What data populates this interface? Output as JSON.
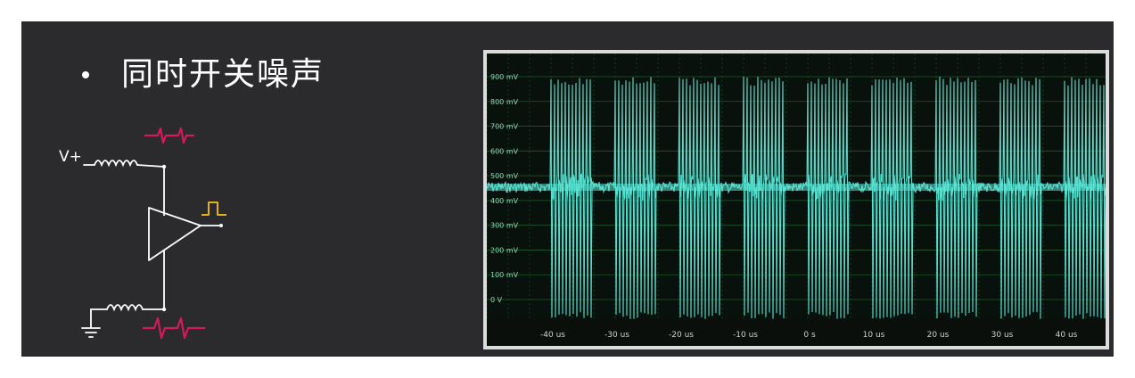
{
  "slide": {
    "bullet_text": "同时开关噪声"
  },
  "circuit": {
    "supply_label": "V+",
    "colors": {
      "wire": "#ffffff",
      "noise_glitch": "#d41a5a",
      "pulse": "#e2b020"
    },
    "icons": [
      "inductor-icon",
      "buffer-triangle-icon",
      "ground-icon",
      "pulse-icon",
      "glitch-icon"
    ]
  },
  "scope": {
    "colors": {
      "trace": "#5fe8d8",
      "grid": "#1f5a2a",
      "frame": "#dcdcdc"
    },
    "y_tick_labels": [
      "900 mV",
      "800 mV",
      "700 mV",
      "600 mV",
      "500 mV",
      "400 mV",
      "300 mV",
      "200 mV",
      "100 mV",
      "0 V"
    ],
    "x_tick_labels": [
      "-40 us",
      "-30 us",
      "-20 us",
      "-10 us",
      "0 s",
      "10 us",
      "20 us",
      "30 us",
      "40 us"
    ]
  }
}
